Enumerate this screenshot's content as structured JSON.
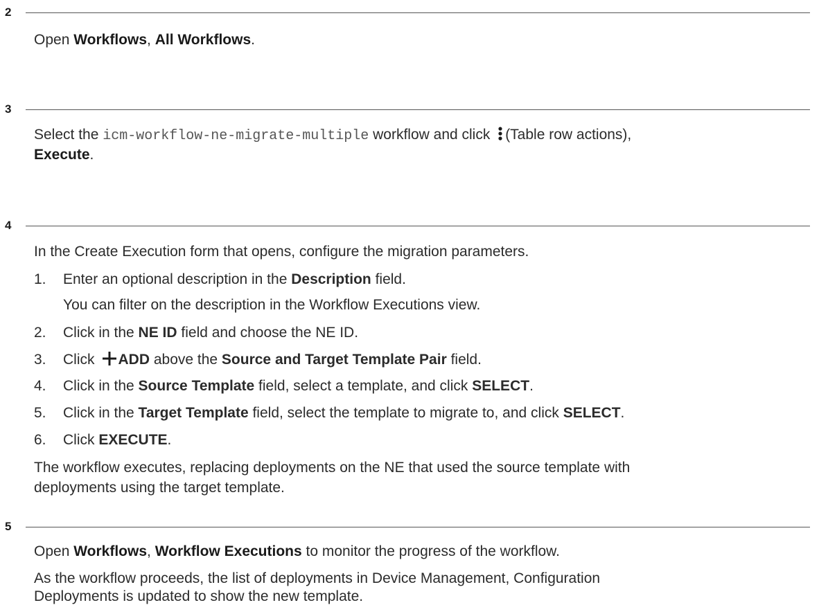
{
  "steps": [
    {
      "number": "2",
      "text": {
        "a": "Open ",
        "b1": "Workflows",
        "c": ", ",
        "b2": "All Workflows",
        "d": "."
      }
    },
    {
      "number": "3",
      "text": {
        "a": "Select the ",
        "code": "icm-workflow-ne-migrate-multiple",
        "b": " workflow and click ",
        "icon": "kebab-icon",
        "c": "(Table row actions),",
        "bold": "Execute",
        "d": "."
      }
    },
    {
      "number": "4",
      "intro": "In the Create Execution form that opens, configure the migration parameters.",
      "substeps": [
        {
          "num": "1.",
          "a": "Enter an optional description in the ",
          "b": "Description",
          "c": " field.",
          "note": "You can filter on the description in the Workflow Executions view."
        },
        {
          "num": "2.",
          "a": "Click in the ",
          "b": "NE ID",
          "c": " field and choose the NE ID."
        },
        {
          "num": "3.",
          "a": "Click",
          "icon": "plus-icon",
          "b": "ADD",
          "c": " above the ",
          "d": "Source and Target Template Pair",
          "e": " field."
        },
        {
          "num": "4.",
          "a": "Click in the ",
          "b": "Source Template",
          "c": " field, select a template, and click ",
          "d": "SELECT",
          "e": "."
        },
        {
          "num": "5.",
          "a": "Click in the ",
          "b": "Target Template",
          "c": " field, select the template to migrate to, and click ",
          "d": "SELECT",
          "e": "."
        },
        {
          "num": "6.",
          "a": "Click ",
          "b": "EXECUTE",
          "c": "."
        }
      ],
      "result_line1": "The workflow executes, replacing deployments on the NE that used the source template with",
      "result_line2": "deployments using the target template."
    },
    {
      "number": "5",
      "text": {
        "a": "Open ",
        "b1": "Workflows",
        "c": ", ",
        "b2": "Workflow Executions",
        "d": " to monitor the progress of the workflow."
      },
      "note_line1": "As the workflow proceeds, the list of deployments in Device Management, Configuration",
      "note_line2": "Deployments is updated to show the new template."
    }
  ]
}
